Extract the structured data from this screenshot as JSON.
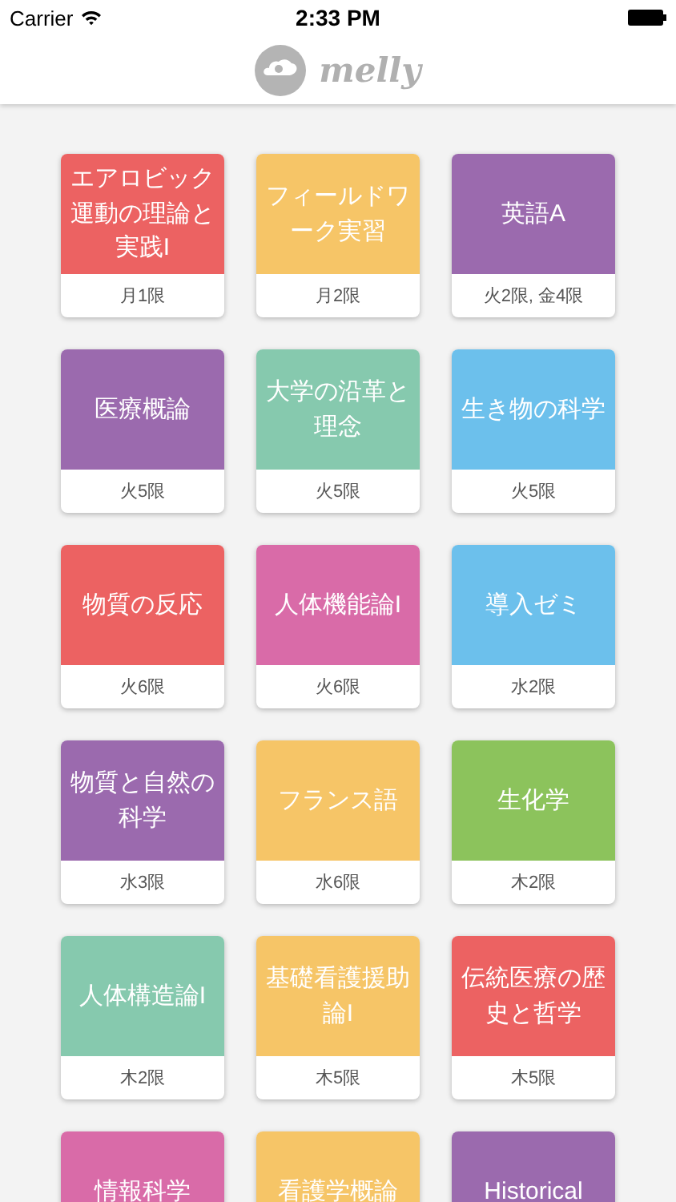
{
  "status_bar": {
    "carrier": "Carrier",
    "time": "2:33 PM"
  },
  "nav": {
    "title": "melly"
  },
  "courses": [
    {
      "name": "エアロビック運動の理論と実践I",
      "schedule": "月1限",
      "color": "#ec6262"
    },
    {
      "name": "フィールドワーク実習",
      "schedule": "月2限",
      "color": "#f6c567"
    },
    {
      "name": "英語A",
      "schedule": "火2限, 金4限",
      "color": "#9b6aae"
    },
    {
      "name": "医療概論",
      "schedule": "火5限",
      "color": "#9b6aae"
    },
    {
      "name": "大学の沿革と理念",
      "schedule": "火5限",
      "color": "#86c9ae"
    },
    {
      "name": "生き物の科学",
      "schedule": "火5限",
      "color": "#6cc0ec"
    },
    {
      "name": "物質の反応",
      "schedule": "火6限",
      "color": "#ec6262"
    },
    {
      "name": "人体機能論I",
      "schedule": "火6限",
      "color": "#d96ba8"
    },
    {
      "name": "導入ゼミ",
      "schedule": "水2限",
      "color": "#6cc0ec"
    },
    {
      "name": "物質と自然の科学",
      "schedule": "水3限",
      "color": "#9b6aae"
    },
    {
      "name": "フランス語",
      "schedule": "水6限",
      "color": "#f6c567"
    },
    {
      "name": "生化学",
      "schedule": "木2限",
      "color": "#8cc35c"
    },
    {
      "name": "人体構造論I",
      "schedule": "木2限",
      "color": "#86c9ae"
    },
    {
      "name": "基礎看護援助論I",
      "schedule": "木5限",
      "color": "#f6c567"
    },
    {
      "name": "伝統医療の歴史と哲学",
      "schedule": "木5限",
      "color": "#ec6262"
    },
    {
      "name": "情報科学",
      "color": "#d96ba8"
    },
    {
      "name": "看護学概論",
      "color": "#f6c567"
    },
    {
      "name": "Historical",
      "color": "#9b6aae"
    }
  ]
}
